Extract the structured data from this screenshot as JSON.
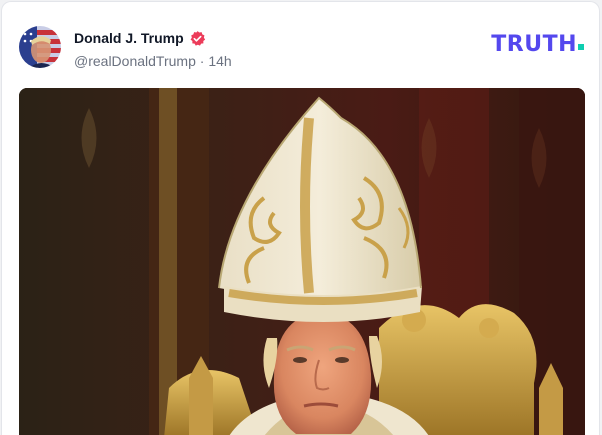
{
  "post": {
    "author_name": "Donald J. Trump",
    "handle": "@realDonaldTrump",
    "separator": "·",
    "time_ago": "14h"
  },
  "brand": {
    "logo_text": "TRUTH",
    "logo_color": "#5448ee",
    "dot_color": "#0eceb0"
  },
  "icons": {
    "verified": "verified-badge-icon"
  },
  "colors": {
    "verified_badge": "#ec3c5a"
  }
}
